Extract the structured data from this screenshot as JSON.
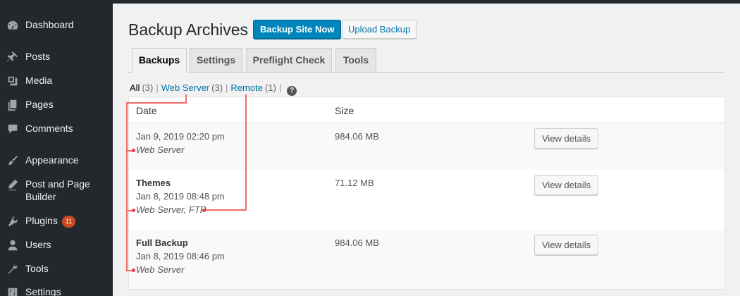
{
  "sidebar": {
    "items": [
      {
        "label": "Dashboard",
        "icon": "dashboard-icon"
      },
      {
        "label": "Posts",
        "icon": "pin-icon"
      },
      {
        "label": "Media",
        "icon": "media-icon"
      },
      {
        "label": "Pages",
        "icon": "pages-icon"
      },
      {
        "label": "Comments",
        "icon": "comment-icon"
      },
      {
        "label": "Appearance",
        "icon": "brush-icon"
      },
      {
        "label": "Post and Page",
        "label2": "Builder",
        "icon": "pencil-icon"
      },
      {
        "label": "Plugins",
        "icon": "plugin-icon",
        "badge": "11"
      },
      {
        "label": "Users",
        "icon": "user-icon"
      },
      {
        "label": "Tools",
        "icon": "wrench-icon"
      },
      {
        "label": "Settings",
        "icon": "settings-icon"
      }
    ]
  },
  "header": {
    "title": "Backup Archives",
    "primary_button": "Backup Site Now",
    "secondary_button": "Upload Backup"
  },
  "tabs": [
    {
      "label": "Backups",
      "active": true
    },
    {
      "label": "Settings",
      "active": false
    },
    {
      "label": "Preflight Check",
      "active": false
    },
    {
      "label": "Tools",
      "active": false
    }
  ],
  "filters": {
    "all_label": "All",
    "all_count": "(3)",
    "web_label": "Web Server",
    "web_count": "(3)",
    "remote_label": "Remote",
    "remote_count": "(1)",
    "separator": "|",
    "help": "?"
  },
  "table": {
    "columns": [
      "Date",
      "Size"
    ],
    "rows": [
      {
        "title": "",
        "date": "Jan 9, 2019 02:20 pm",
        "location": "Web Server",
        "size": "984.06 MB",
        "action": "View details"
      },
      {
        "title": "Themes",
        "date": "Jan 8, 2019 08:48 pm",
        "location": "Web Server, FTP",
        "size": "71.12 MB",
        "action": "View details"
      },
      {
        "title": "Full Backup",
        "date": "Jan 8, 2019 08:46 pm",
        "location": "Web Server",
        "size": "984.06 MB",
        "action": "View details"
      }
    ]
  },
  "colors": {
    "sidebar_bg": "#23282d",
    "primary": "#0085ba",
    "link": "#0073aa",
    "badge": "#ca4a1f",
    "annotation": "#f36b6b"
  }
}
